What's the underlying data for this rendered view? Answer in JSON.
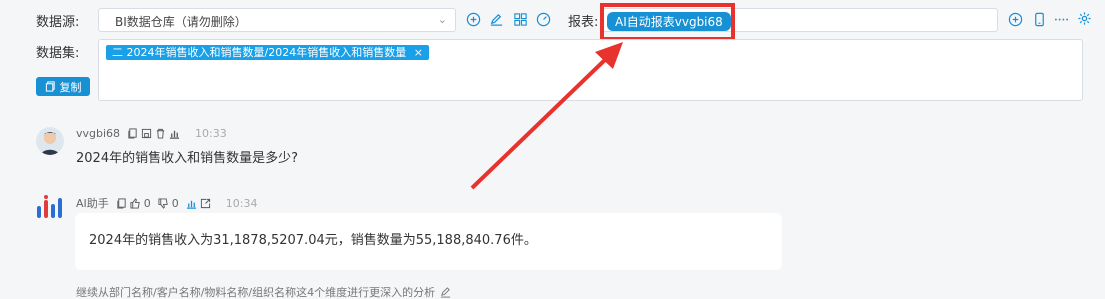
{
  "toolbar": {
    "datasource_label": "数据源:",
    "datasource_value": "BI数据仓库（请勿删除）",
    "report_label": "报表:",
    "report_tag": "AI自动报表vvgbi68",
    "dataset_label": "数据集:",
    "dataset_tag": "二 2024年销售收入和销售数量/2024年销售收入和销售数量",
    "dataset_tag_close": "×",
    "copy_label": "复制"
  },
  "messages": [
    {
      "user": "vvgbi68",
      "time": "10:33",
      "text": "2024年的销售收入和销售数量是多少?"
    },
    {
      "user": "AI助手",
      "likes": "0",
      "dislikes": "0",
      "time": "10:34",
      "text": "2024年的销售收入为31,1878,5207.04元，销售数量为55,188,840.76件。"
    }
  ],
  "hint": "继续从部门名称/客户名称/物料名称/组织名称这4个维度进行更深入的分析",
  "colors": {
    "accent": "#1890d4",
    "annotation": "#e8322d"
  }
}
